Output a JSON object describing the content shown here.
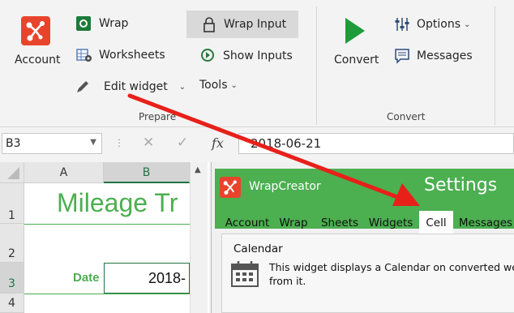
{
  "ribbon": {
    "account_label": "Account",
    "wrap_label": "Wrap",
    "worksheets_label": "Worksheets",
    "edit_widget_label": "Edit widget",
    "wrap_input_label": "Wrap Input",
    "show_inputs_label": "Show Inputs",
    "tools_label": "Tools",
    "convert_label": "Convert",
    "options_label": "Options",
    "messages_label": "Messages",
    "group_prepare": "Prepare",
    "group_convert": "Convert",
    "accent": "#e8442c",
    "convert_green": "#1e9b3a"
  },
  "formula_bar": {
    "name_box": "B3",
    "fx_symbol": "fx",
    "value": "2018-06-21"
  },
  "sheet": {
    "columns": [
      "A",
      "B"
    ],
    "rows": [
      "1",
      "2",
      "3",
      "4"
    ],
    "title_text": "Mileage Tr",
    "date_label": "Date",
    "date_value": "2018-",
    "title_color": "#4caf50"
  },
  "panel": {
    "app_name": "WrapCreator",
    "heading": "Settings",
    "tabs": [
      "Account",
      "Wrap",
      "Sheets",
      "Widgets",
      "Cell",
      "Messages"
    ],
    "active_tab": "Cell",
    "widget_title": "Calendar",
    "widget_desc_line1": "This widget displays a Calendar on converted webp",
    "widget_desc_line2": "from it.",
    "header_color": "#4caf50"
  }
}
